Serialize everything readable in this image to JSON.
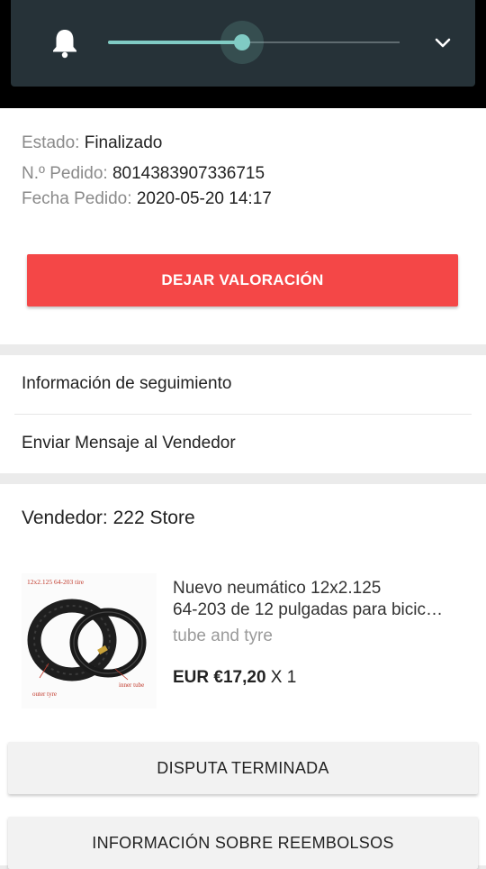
{
  "volume": {
    "level": 0.46,
    "accent_color": "#80cbc4",
    "icon_left": "bell-icon",
    "icon_right": "chevron-down-icon"
  },
  "order": {
    "status_label": "Estado:",
    "status_value": "Finalizado",
    "number_label": "N.º Pedido:",
    "number_value": "8014383907336715",
    "date_label": "Fecha Pedido:",
    "date_value": "2020-05-20 14:17",
    "review_button": "DEJAR VALORACIÓN",
    "review_button_color": "#f44747"
  },
  "links": {
    "tracking": "Información de seguimiento",
    "message_seller": "Enviar Mensaje al Vendedor"
  },
  "seller": {
    "label": "Vendedor: 222 Store"
  },
  "product": {
    "title_line1": "Nuevo neumático 12x2.125",
    "title_line2": "64-203 de 12 pulgadas para bicic…",
    "variant": "tube and tyre",
    "price": "EUR €17,20",
    "quantity": "X 1",
    "image_text": {
      "top": "12x2.125  64-203  tire",
      "outer": "outer tyre",
      "inner": "inner tube"
    }
  },
  "actions": {
    "dispute": "DISPUTA TERMINADA",
    "refund_info": "INFORMACIÓN SOBRE REEMBOLSOS"
  }
}
